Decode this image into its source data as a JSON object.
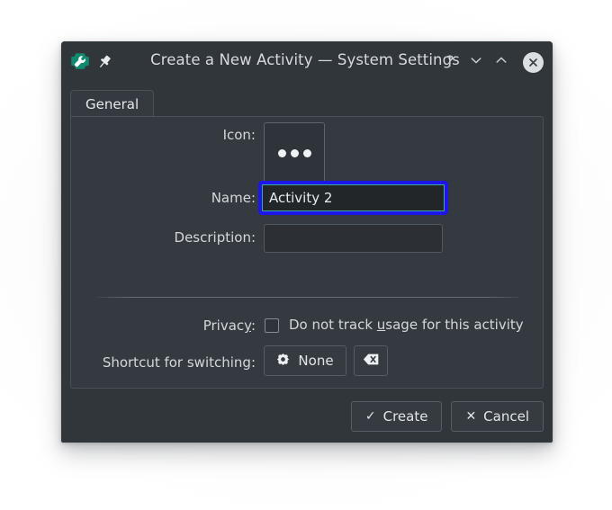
{
  "window": {
    "title": "Create a New Activity — System Settings",
    "app_icon": "wrench-icon",
    "pin_icon": "pin-icon",
    "controls": {
      "help": "?",
      "minimize": "⌄",
      "maximize": "⌃",
      "close": "✕"
    }
  },
  "tabs": [
    {
      "label": "General",
      "active": true
    }
  ],
  "form": {
    "icon": {
      "label": "Icon:",
      "button_glyph": "ellipsis-icon"
    },
    "name": {
      "label": "Name:",
      "value": "Activity 2",
      "placeholder": "",
      "focused": true
    },
    "description": {
      "label": "Description:",
      "value": "",
      "placeholder": ""
    },
    "privacy": {
      "label": "Privacy:",
      "checkbox_text_before": "Do not track ",
      "checkbox_accel": "u",
      "checkbox_text_after": "sage for this activity",
      "checked": false
    },
    "shortcut": {
      "label": "Shortcut for switching:",
      "value": "None",
      "icon": "gear-icon",
      "clear_icon": "backspace-icon"
    }
  },
  "footer": {
    "create": "Create",
    "create_glyph": "✓",
    "cancel": "Cancel",
    "cancel_glyph": "✕"
  },
  "colors": {
    "window_bg": "#31363b",
    "panel_bg": "#343a40",
    "focus_blue": "#1d16ea",
    "input_border_teal": "#3daa9f",
    "app_icon_teal": "#169b7d",
    "text": "#d4d8dc"
  }
}
